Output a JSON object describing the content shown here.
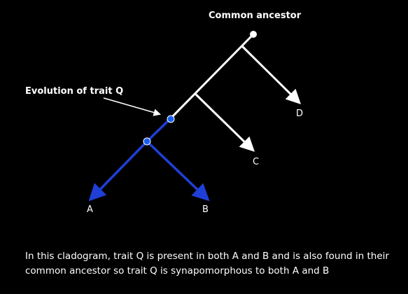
{
  "title": "Common ancestor",
  "trait_label": "Evolution of trait Q",
  "taxa": {
    "a": "A",
    "b": "B",
    "c": "C",
    "d": "D"
  },
  "caption": "In this cladogram, trait Q is present in both A and B and is also found in their common ancestor so trait Q is synapomorphous to both A and B",
  "colors": {
    "background": "#000000",
    "line": "#ffffff",
    "trait": "#1f3fd6",
    "node_white": "#ffffff",
    "node_blue": "#1a5ef0"
  }
}
